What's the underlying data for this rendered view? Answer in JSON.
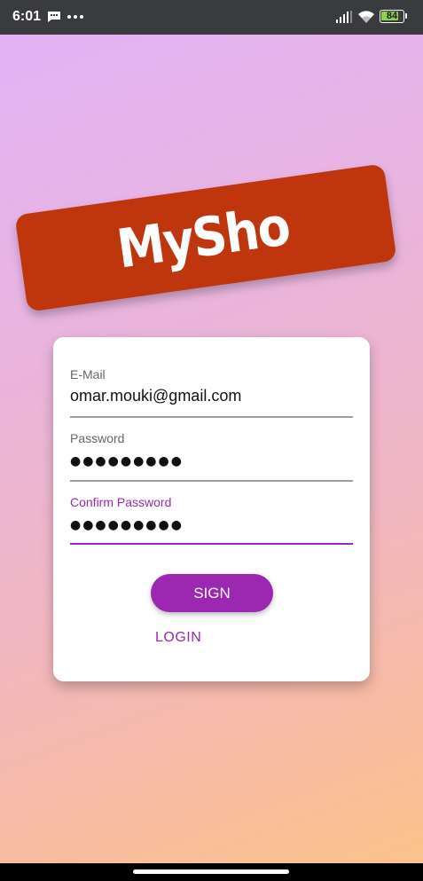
{
  "status_bar": {
    "time": "6:01",
    "battery": "84",
    "battery_level": 0.84,
    "icons": [
      "message-icon",
      "more-dots-icon",
      "signal-icon",
      "wifi-icon",
      "battery-icon"
    ]
  },
  "logo": {
    "text": "MySho"
  },
  "form": {
    "email": {
      "label": "E-Mail",
      "value": "omar.mouki@gmail.com"
    },
    "password": {
      "label": "Password",
      "value": "●●●●●●●●●"
    },
    "confirm_password": {
      "label": "Confirm Password",
      "value": "●●●●●●●●●",
      "focused": true
    },
    "sign_button": "SIGN",
    "login_link": "LOGIN"
  },
  "colors": {
    "accent": "#9c27b0",
    "logo_bg": "#bf350d",
    "battery_green": "#8bd14a",
    "status_bar_bg": "#3a3b3e"
  }
}
